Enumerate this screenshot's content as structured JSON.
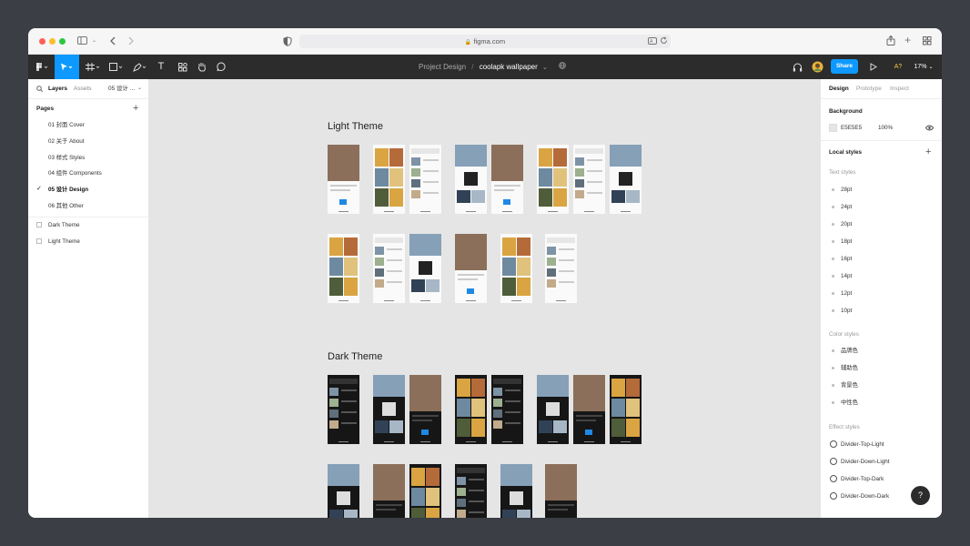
{
  "browser": {
    "url": "figma.com"
  },
  "toolbar": {
    "project": "Project Design",
    "separator": "/",
    "file": "coolapk wallpaper",
    "share": "Share",
    "text_tool": "T",
    "font_tool": "A?",
    "zoom": "17%"
  },
  "left_panel": {
    "tabs": [
      "Layers",
      "Assets",
      "05 设计 ..."
    ],
    "pages_title": "Pages",
    "pages": [
      "01 封面 Cover",
      "02 关于 About",
      "03 样式 Styles",
      "04 组件 Components",
      "05 设计 Design",
      "06 其他 Other"
    ],
    "selected_check": "✓",
    "layers": [
      "Dark Theme",
      "Light Theme"
    ]
  },
  "canvas": {
    "light_title": "Light Theme",
    "dark_title": "Dark Theme"
  },
  "right_panel": {
    "tabs": [
      "Design",
      "Prototype",
      "Inspect"
    ],
    "background_title": "Background",
    "bg_hex": "E5E5E5",
    "bg_opacity": "100%",
    "local_styles": "Local styles",
    "text_styles_title": "Text styles",
    "text_styles": [
      "28pt",
      "24pt",
      "20pt",
      "18pt",
      "16pt",
      "14pt",
      "12pt",
      "10pt"
    ],
    "color_styles_title": "Color styles",
    "color_styles": [
      "品牌色",
      "辅助色",
      "背景色",
      "中性色"
    ],
    "effect_styles_title": "Effect styles",
    "effect_styles": [
      "Divider-Top-Light",
      "Divider-Down-Light",
      "Divider-Top-Dark",
      "Divider-Down-Dark"
    ]
  },
  "help": "?",
  "colors": {
    "accent": "#0d99ff",
    "toolbar": "#2c2c2c",
    "canvas": "#e5e5e5"
  }
}
